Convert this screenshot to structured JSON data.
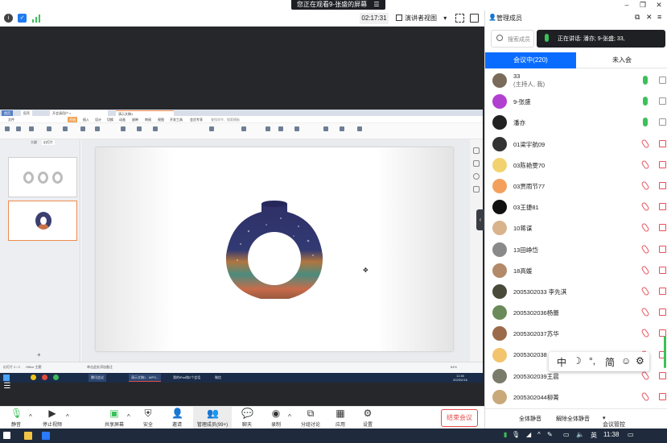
{
  "titlebar": {
    "sharing_label": "您正在观看9-张盛的屏幕"
  },
  "meeting_top": {
    "timer": "02:17:31",
    "view_label": "演讲者视图"
  },
  "wps": {
    "tabs": [
      "首页",
      "稻壳",
      "开会请用户 ×",
      "演示文稿1"
    ],
    "menu_items": [
      "文件",
      "开始",
      "插入",
      "设计",
      "切换",
      "动画",
      "放映",
      "审阅",
      "视图",
      "开发工具",
      "会员专享",
      "查找命令、搜索模板"
    ],
    "left_tabs": [
      "大纲",
      "幻灯片"
    ],
    "status_left": "幻灯片 2 / 2",
    "status_theme": "Office 主题",
    "notes_hint": "单击此处添加备注",
    "zoom": "84%"
  },
  "win_taskbar_apps": [
    "腾讯会议",
    "演示文稿1 - WPS...",
    "我的iPad和2个会话",
    "微信"
  ],
  "win_clock": {
    "time": "11:38",
    "date": "2023/2/16"
  },
  "toolbar": {
    "mute_label": "静音",
    "video_label": "停止视频",
    "share_label": "共享屏幕",
    "security_label": "安全",
    "invite_label": "邀请",
    "manage_label": "管理成员(99+)",
    "chat_label": "聊天",
    "record_label": "录制",
    "breakout_label": "分组讨论",
    "apps_label": "应用",
    "settings_label": "设置",
    "end_label": "结束会议"
  },
  "panel": {
    "title": "管理成员",
    "search_placeholder": "搜索成员",
    "speaking": "正在讲话: 潘亦; 9-张盛; 33,",
    "tab_in": "会议中(220)",
    "tab_out": "未入会",
    "participants": [
      {
        "name": "33",
        "sub": "(主持人, 我)",
        "mic": "on"
      },
      {
        "name": "9-张盛",
        "sub": "",
        "mic": "on"
      },
      {
        "name": "潘亦",
        "sub": "",
        "mic": "on"
      },
      {
        "name": "01梁宇航09",
        "sub": "",
        "mic": "off"
      },
      {
        "name": "03陈艳雯70",
        "sub": "",
        "mic": "off"
      },
      {
        "name": "03贾雨节77",
        "sub": "",
        "mic": "off"
      },
      {
        "name": "03王捷81",
        "sub": "",
        "mic": "off"
      },
      {
        "name": "10蒋谋",
        "sub": "",
        "mic": "off"
      },
      {
        "name": "13田峥岱",
        "sub": "",
        "mic": "off"
      },
      {
        "name": "18高媛",
        "sub": "",
        "mic": "off"
      },
      {
        "name": "2005302033 李先淇",
        "sub": "",
        "mic": "off"
      },
      {
        "name": "2005302036杨蕾",
        "sub": "",
        "mic": "off"
      },
      {
        "name": "2005302037苏华",
        "sub": "",
        "mic": "off"
      },
      {
        "name": "2005302038",
        "sub": "",
        "mic": "off"
      },
      {
        "name": "2005302039王晨",
        "sub": "",
        "mic": "off"
      },
      {
        "name": "2005302044柳菁",
        "sub": "",
        "mic": "off"
      }
    ],
    "footer": {
      "mute_all": "全体静音",
      "unmute_all": "解除全体静音",
      "control": "会议管控"
    }
  },
  "ime": [
    "中",
    "☽",
    "°,",
    "简",
    "☺",
    "⚙"
  ],
  "taskbar": {
    "ime_mode": "英",
    "time": "11:38"
  },
  "colors": {
    "accent": "#0a6cff",
    "mic_on": "#3cc05a",
    "mic_off": "#e8505b",
    "end": "#e84a4a"
  }
}
